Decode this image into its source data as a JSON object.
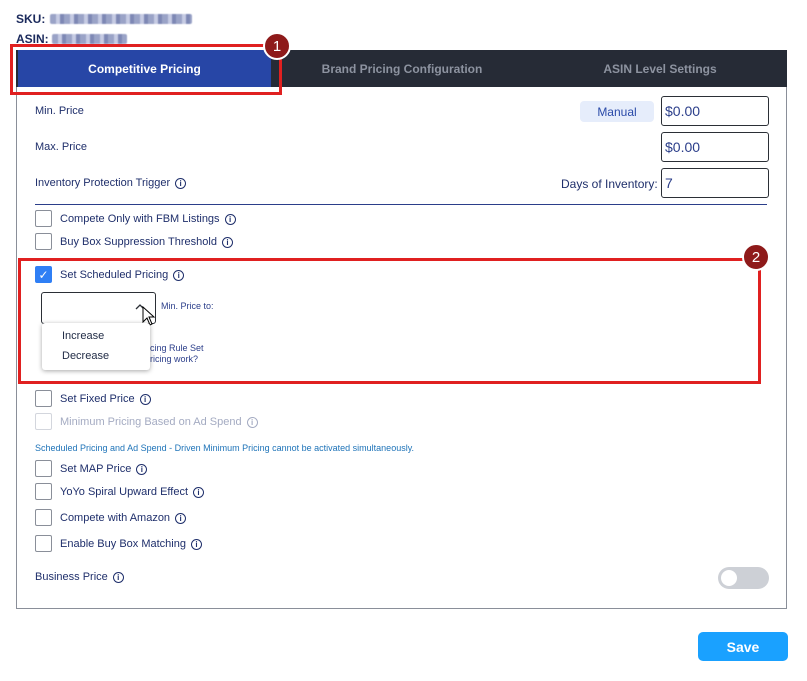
{
  "header": {
    "sku_label": "SKU:",
    "asin_label": "ASIN:"
  },
  "tabs": [
    {
      "label": "Competitive Pricing",
      "active": true
    },
    {
      "label": "Brand Pricing Configuration",
      "active": false
    },
    {
      "label": "ASIN Level Settings",
      "active": false
    }
  ],
  "fields": {
    "min_price_label": "Min. Price",
    "manual_label": "Manual",
    "min_price_value": "$0.00",
    "max_price_label": "Max. Price",
    "max_price_value": "$0.00",
    "inventory_trigger_label": "Inventory Protection Trigger",
    "days_inventory_label": "Days of Inventory:",
    "days_inventory_value": "7"
  },
  "options": {
    "fbm_only": "Compete Only with FBM Listings",
    "buybox_suppression": "Buy Box Suppression Threshold",
    "scheduled_pricing": "Set Scheduled Pricing",
    "fixed_price": "Set Fixed Price",
    "ad_spend_min": "Minimum Pricing Based on Ad Spend",
    "conflict_note": "Scheduled Pricing and Ad Spend - Driven Minimum Pricing cannot be activated simultaneously.",
    "map_price": "Set MAP Price",
    "yoyo": "YoYo Spiral Upward Effect",
    "compete_amazon": "Compete with Amazon",
    "buybox_matching": "Enable Buy Box Matching",
    "business_price": "Business Price"
  },
  "scheduled": {
    "min_price_to": "Min. Price to:",
    "rule_set_partial": "icing Rule Set",
    "how_works_partial": "ricing work?",
    "dropdown_options": [
      "Increase",
      "Decrease"
    ]
  },
  "annotations": {
    "badge1": "1",
    "badge2": "2"
  },
  "save_label": "Save",
  "colors": {
    "active_tab": "#2746a6",
    "tabbar": "#262b36",
    "highlight_red": "#e02020",
    "save": "#1aa1ff"
  }
}
